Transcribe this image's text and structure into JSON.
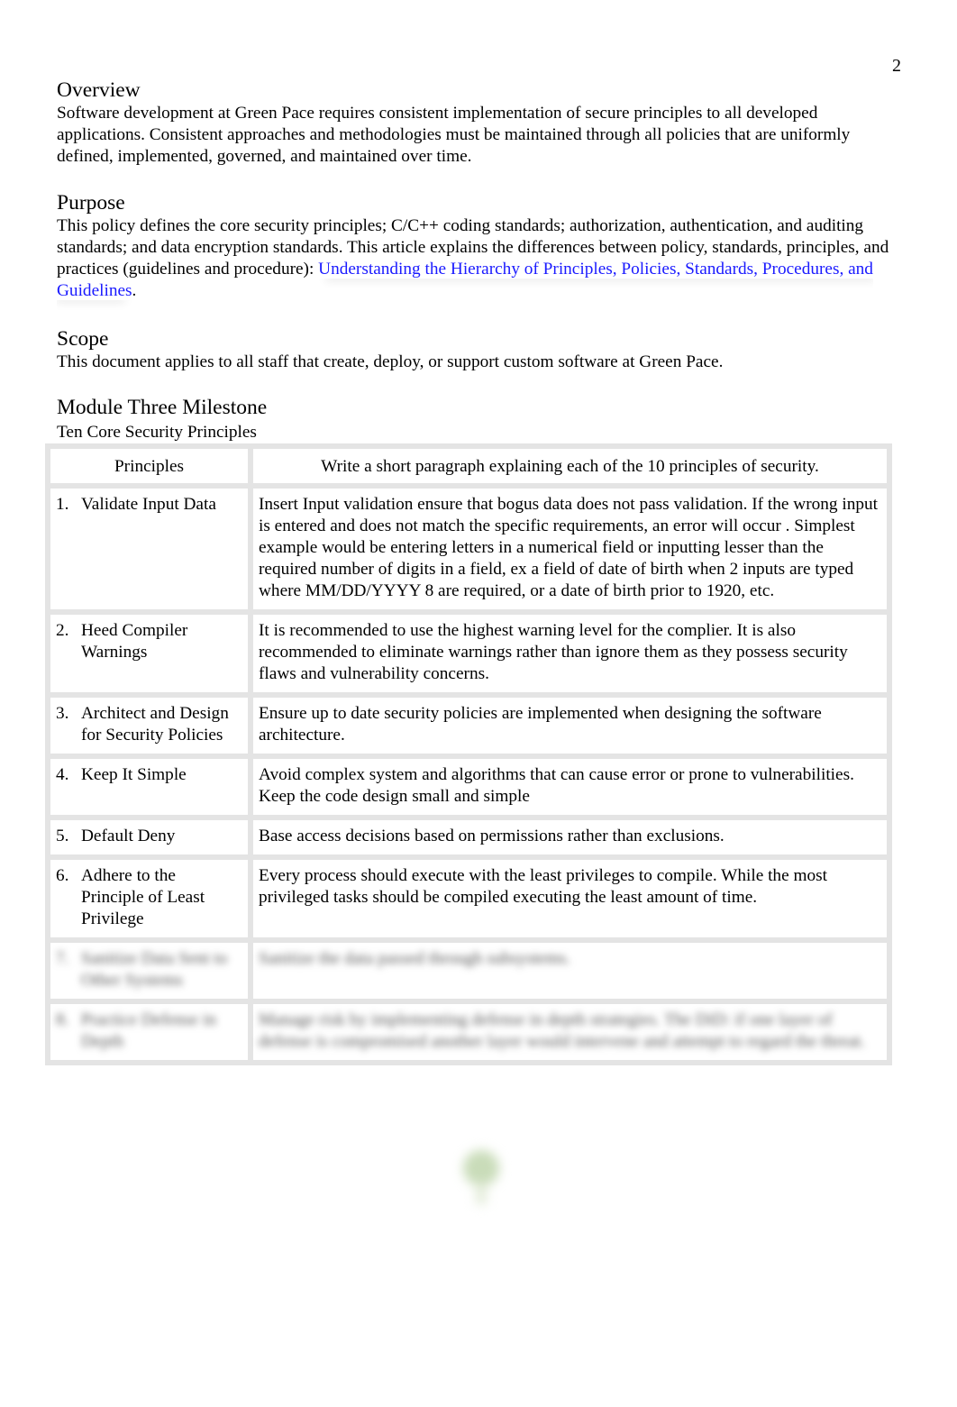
{
  "page_number": "2",
  "overview": {
    "heading": "Overview",
    "body": "Software development at Green Pace requires consistent implementation of secure principles to all developed applications. Consistent approaches and methodologies must be maintained through all policies that are uniformly defined, implemented, governed, and maintained over time."
  },
  "purpose": {
    "heading": "Purpose",
    "body": "This policy defines the core security principles; C/C++ coding standards; authorization, authentication, and auditing standards; and data encryption standards. This article explains the differences between policy, standards, principles, and practices (guidelines and procedure): ",
    "link_text": "Understanding the Hierarchy of Principles, Policies, Standards, Procedures, and Guidelines",
    "trailing": "."
  },
  "scope": {
    "heading": "Scope",
    "body": "This document applies to all staff that create, deploy, or support custom software at Green Pace."
  },
  "module": {
    "heading": "Module Three Milestone",
    "subheading": "Ten Core Security Principles"
  },
  "table": {
    "headers": [
      "Principles",
      "Write a short paragraph explaining each of the 10 principles of security."
    ],
    "rows": [
      {
        "num": "1.",
        "name": "Validate Input Data",
        "text": "Insert Input validation ensure that bogus data does not pass validation. If the wrong input is entered and does not match the specific requirements, an error will occur . Simplest example would be entering letters in a numerical field or inputting lesser than the required number of digits in a field, ex a field of date of birth when 2 inputs are typed where MM/DD/YYYY 8 are required, or a date of birth prior to 1920, etc."
      },
      {
        "num": "2.",
        "name": "Heed Compiler Warnings",
        "text": "It is recommended to use the highest warning level for the complier. It is also recommended to eliminate warnings rather than ignore them as they possess security flaws and vulnerability concerns."
      },
      {
        "num": "3.",
        "name": "Architect and Design for Security Policies",
        "text": "Ensure up to date security policies are implemented when designing the software architecture."
      },
      {
        "num": "4.",
        "name": "Keep It Simple",
        "text": "Avoid complex system and algorithms that can cause error or prone to vulnerabilities. Keep the code design small and simple"
      },
      {
        "num": "5.",
        "name": "Default Deny",
        "text": "Base access decisions based on permissions rather than exclusions."
      },
      {
        "num": "6.",
        "name": "Adhere to the Principle of Least Privilege",
        "text": "Every process should execute with the least privileges to compile. While the most privileged tasks should be compiled executing the least amount of time."
      },
      {
        "num": "7.",
        "name": "Sanitize Data Sent to Other Systems",
        "text": "Sanitize the data passed through subsystems."
      },
      {
        "num": "8.",
        "name": "Practice Defense in Depth",
        "text": "Manage risk by implementing defense in depth strategies. The DiD: if one layer of defense is compromised another layer would intervene and attempt to regard the threat."
      }
    ]
  },
  "logo": {
    "icon": "tree-logo-icon"
  }
}
